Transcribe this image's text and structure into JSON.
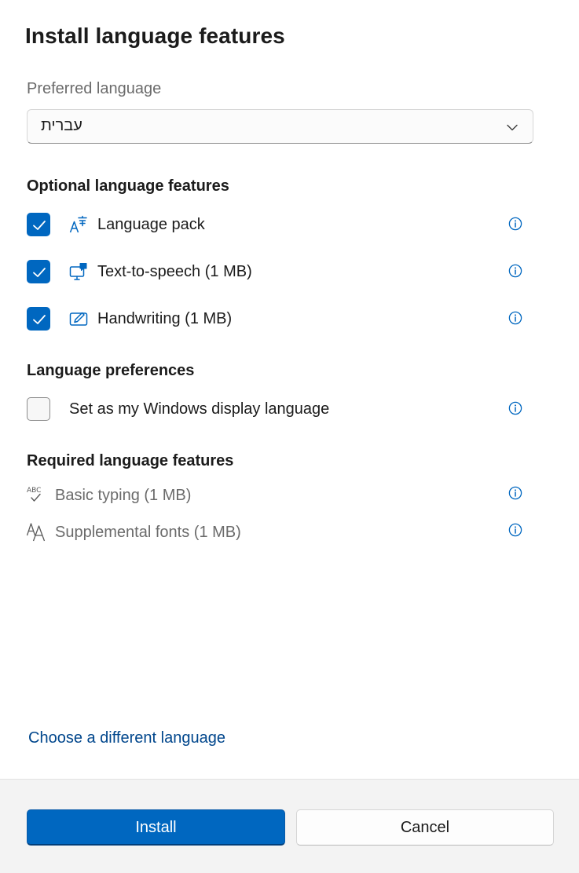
{
  "dialog": {
    "title": "Install language features"
  },
  "preferred_language": {
    "label": "Preferred language",
    "selected": "עברית"
  },
  "optional_features": {
    "header": "Optional language features",
    "items": [
      {
        "label": "Language pack",
        "checked": true,
        "icon": "language-pack-icon"
      },
      {
        "label": "Text-to-speech (1 MB)",
        "checked": true,
        "icon": "text-to-speech-icon"
      },
      {
        "label": "Handwriting (1 MB)",
        "checked": true,
        "icon": "handwriting-icon"
      }
    ]
  },
  "language_preferences": {
    "header": "Language preferences",
    "items": [
      {
        "label": "Set as my Windows display language",
        "checked": false
      }
    ]
  },
  "required_features": {
    "header": "Required language features",
    "items": [
      {
        "label": "Basic typing (1 MB)",
        "icon": "basic-typing-icon"
      },
      {
        "label": "Supplemental fonts (1 MB)",
        "icon": "supplemental-fonts-icon"
      }
    ]
  },
  "links": {
    "choose_language": "Choose a different language"
  },
  "footer": {
    "install_label": "Install",
    "cancel_label": "Cancel"
  },
  "colors": {
    "accent": "#0067c0",
    "link": "#00468c",
    "footer_bg": "#f3f3f3"
  }
}
